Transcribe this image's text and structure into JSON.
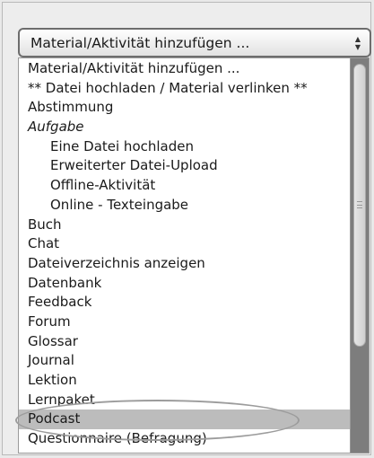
{
  "select": {
    "label": "Material/Aktivität hinzufügen ...",
    "arrow_up": "▲",
    "arrow_down": "▼"
  },
  "options": [
    {
      "label": "Material/Aktivität hinzufügen ...",
      "style": "normal"
    },
    {
      "label": "** Datei hochladen / Material verlinken **",
      "style": "normal"
    },
    {
      "label": "Abstimmung",
      "style": "normal"
    },
    {
      "label": "Aufgabe",
      "style": "group"
    },
    {
      "label": "Eine Datei hochladen",
      "style": "indent"
    },
    {
      "label": "Erweiterter Datei-Upload",
      "style": "indent"
    },
    {
      "label": "Offline-Aktivität",
      "style": "indent"
    },
    {
      "label": "Online - Texteingabe",
      "style": "indent"
    },
    {
      "label": "Buch",
      "style": "normal"
    },
    {
      "label": "Chat",
      "style": "normal"
    },
    {
      "label": "Dateiverzeichnis anzeigen",
      "style": "normal"
    },
    {
      "label": "Datenbank",
      "style": "normal"
    },
    {
      "label": "Feedback",
      "style": "normal"
    },
    {
      "label": "Forum",
      "style": "normal"
    },
    {
      "label": "Glossar",
      "style": "normal"
    },
    {
      "label": "Journal",
      "style": "normal"
    },
    {
      "label": "Lektion",
      "style": "normal"
    },
    {
      "label": "Lernpaket",
      "style": "normal"
    },
    {
      "label": "Podcast",
      "style": "selected"
    },
    {
      "label": "Questionnaire (Befragung)",
      "style": "normal"
    }
  ],
  "colors": {
    "selected_bg": "#bcbcbc",
    "annotation": "#9c9c9c"
  }
}
